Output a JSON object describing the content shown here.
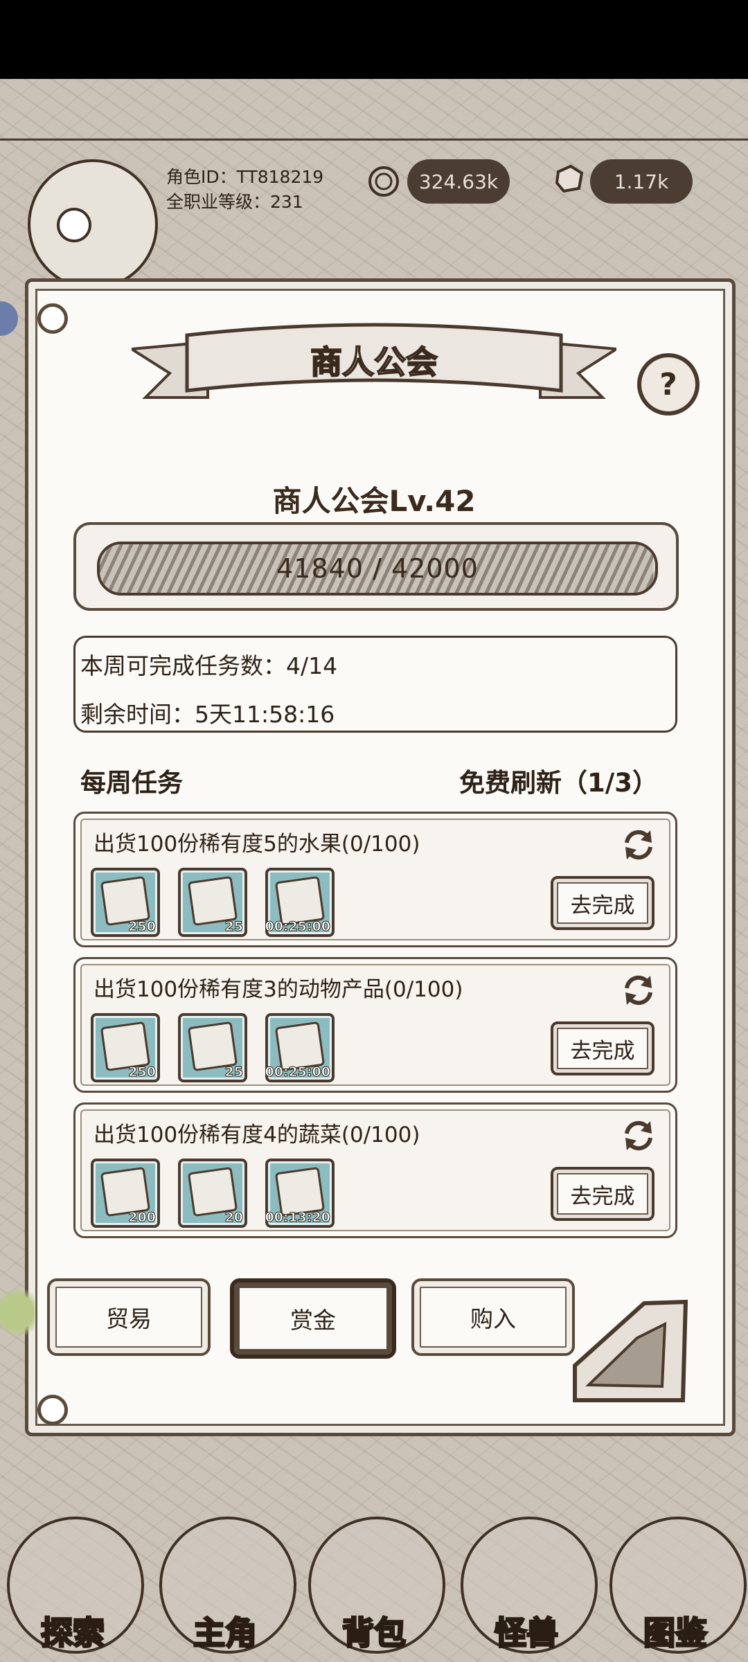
{
  "hud": {
    "role_id": "角色ID：TT818219",
    "total_level": "全职业等级：231",
    "coins": "324.63k",
    "gems": "1.17k"
  },
  "panel": {
    "title": "商人公会",
    "help": "?",
    "guild_level": "商人公会Lv.42",
    "progress_text": "41840 / 42000",
    "progress_fraction": 0.9962,
    "weekly_tasks_available": "本周可完成任务数：4/14",
    "time_remaining": "剩余时间：5天11:58:16",
    "weekly_tasks_title": "每周任务",
    "free_refresh": "免费刷新（1/3）"
  },
  "tasks": [
    {
      "title": "出货100份稀有度5的水果(0/100)",
      "rewards": [
        "250",
        "25",
        "00:25:00"
      ],
      "action": "去完成"
    },
    {
      "title": "出货100份稀有度3的动物产品(0/100)",
      "rewards": [
        "250",
        "25",
        "00:25:00"
      ],
      "action": "去完成"
    },
    {
      "title": "出货100份稀有度4的蔬菜(0/100)",
      "rewards": [
        "200",
        "20",
        "00:13:20"
      ],
      "action": "去完成"
    }
  ],
  "tabs": [
    "贸易",
    "赏金",
    "购入"
  ],
  "bottom_nav": [
    "探索",
    "主角",
    "背包",
    "怪兽",
    "图鉴"
  ]
}
